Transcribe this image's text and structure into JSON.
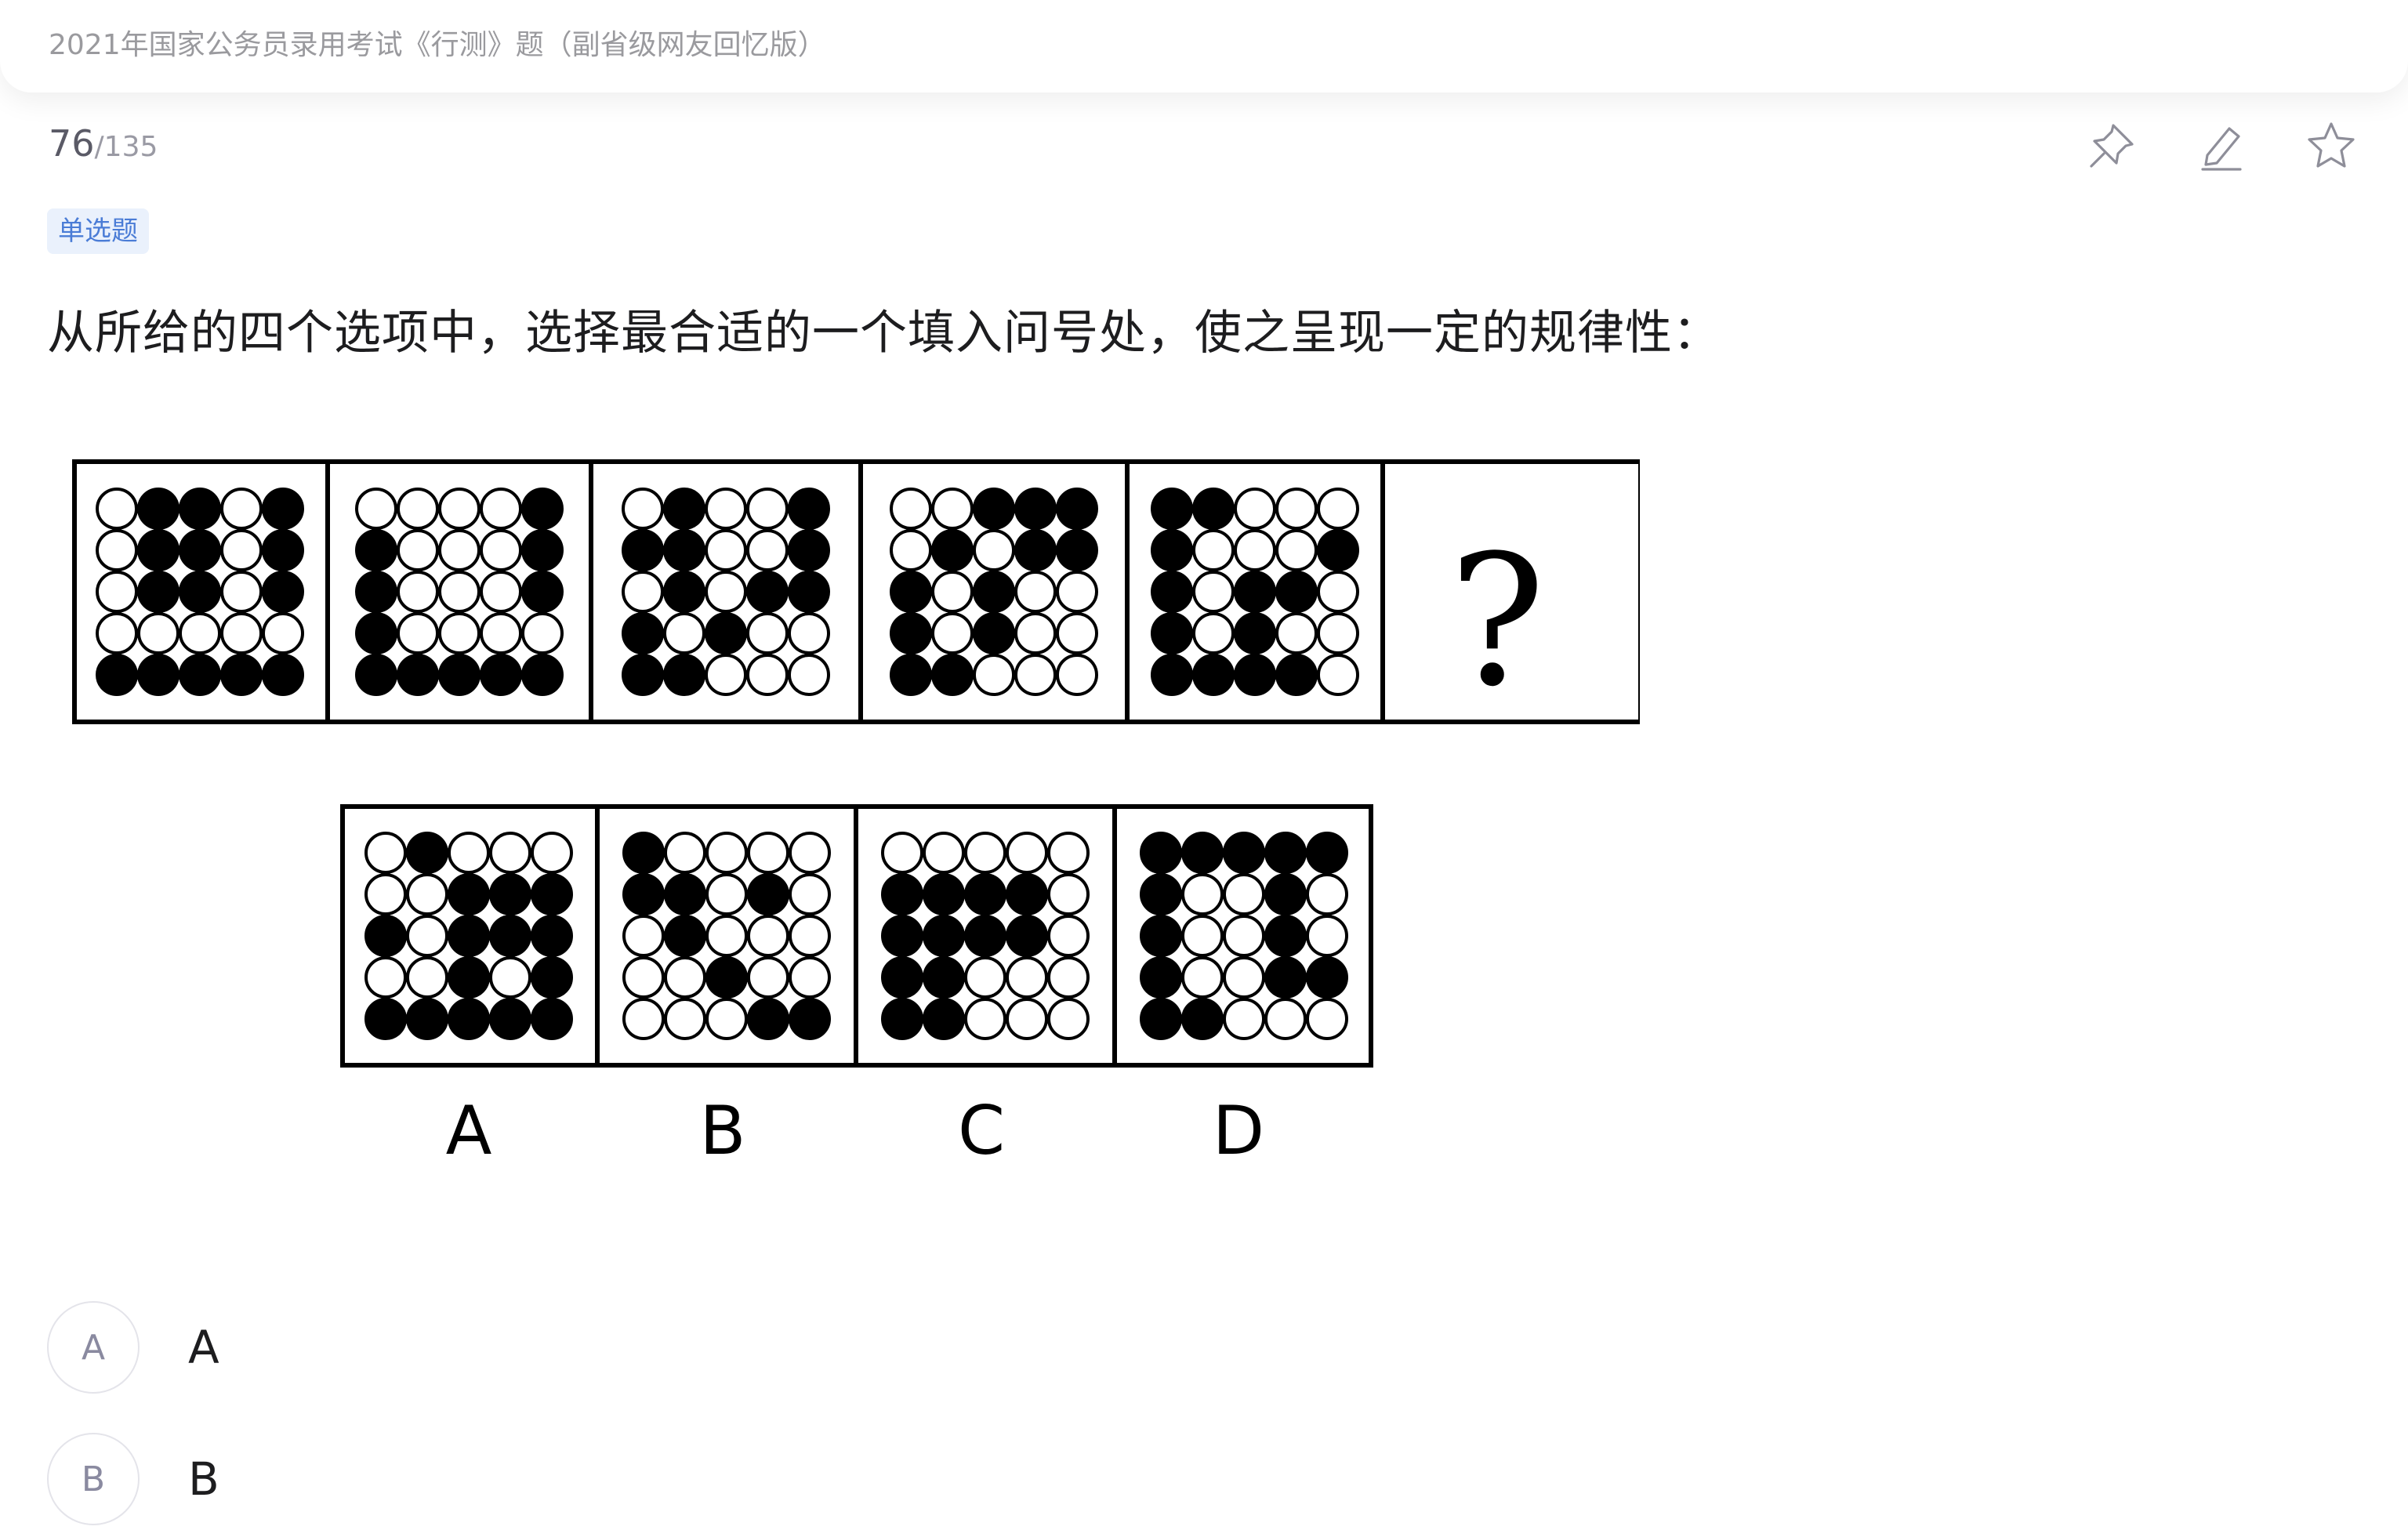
{
  "header": {
    "exam_title": "2021年国家公务员录用考试《行测》题（副省级网友回忆版）"
  },
  "progress": {
    "current": "76",
    "total": "/135"
  },
  "toolbar": {
    "icons": [
      "pin-icon",
      "edit-icon",
      "star-icon"
    ]
  },
  "question": {
    "type_tag": "单选题",
    "stem": "从所给的四个选项中，选择最合适的一个填入问号处，使之呈现一定的规律性：",
    "figure": {
      "question_mark": "?",
      "option_labels": [
        "A",
        "B",
        "C",
        "D"
      ]
    }
  },
  "options": [
    {
      "key": "A",
      "text": "A"
    },
    {
      "key": "B",
      "text": "B"
    }
  ]
}
